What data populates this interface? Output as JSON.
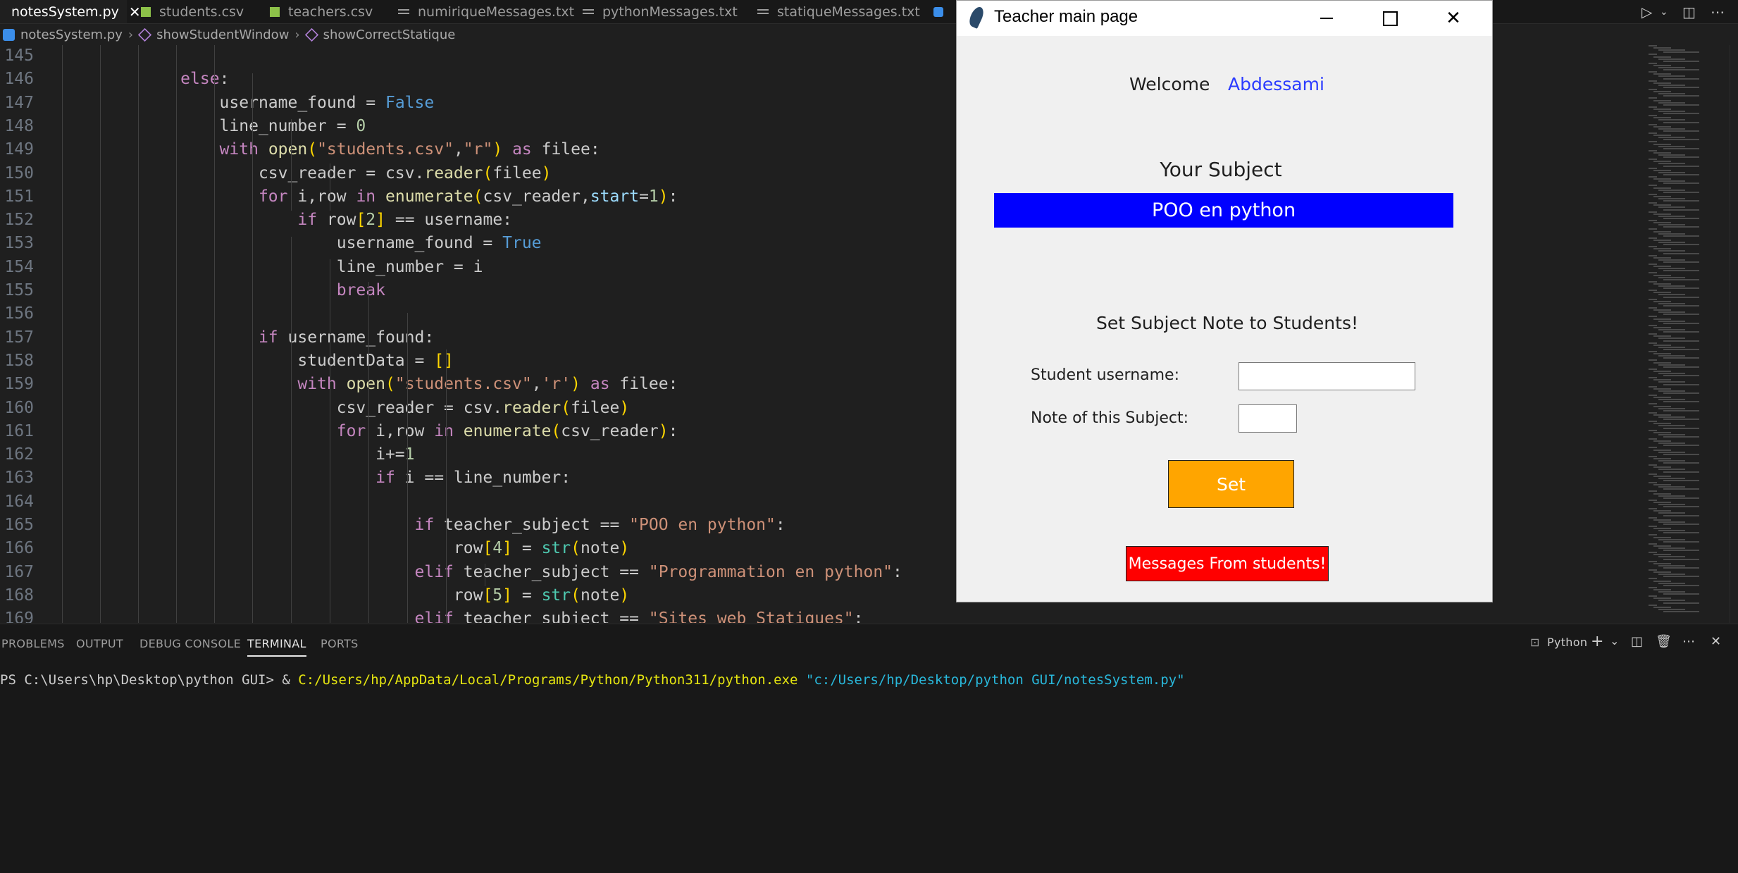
{
  "editor_tabs": [
    {
      "label": "notesSystem.py",
      "close": "✕",
      "type": "py"
    },
    {
      "label": "students.csv",
      "type": "csv"
    },
    {
      "label": "teachers.csv",
      "type": "csv"
    },
    {
      "label": "numiriqueMessages.txt",
      "type": "txt"
    },
    {
      "label": "pythonMessages.txt",
      "type": "txt"
    },
    {
      "label": "statiqueMessages.txt",
      "type": "txt"
    }
  ],
  "breadcrumbs": [
    "notesSystem.py",
    "showStudentWindow",
    "showCorrectStatique"
  ],
  "code_lines": [
    {
      "n": "145",
      "tokens": []
    },
    {
      "n": "146",
      "tokens": [
        {
          "t": "            ",
          "c": "#cccccc"
        },
        {
          "t": "else",
          "c": "#c586c0"
        },
        {
          "t": ":",
          "c": "#cccccc"
        }
      ]
    },
    {
      "n": "147",
      "tokens": [
        {
          "t": "                username_found = ",
          "c": "#cccccc"
        },
        {
          "t": "False",
          "c": "#569cd6"
        }
      ]
    },
    {
      "n": "148",
      "tokens": [
        {
          "t": "                line_number = ",
          "c": "#cccccc"
        },
        {
          "t": "0",
          "c": "#b5cea8"
        }
      ]
    },
    {
      "n": "149",
      "tokens": [
        {
          "t": "                ",
          "c": "#cccccc"
        },
        {
          "t": "with",
          "c": "#c586c0"
        },
        {
          "t": " ",
          "c": "#cccccc"
        },
        {
          "t": "open",
          "c": "#dcdcaa"
        },
        {
          "t": "(",
          "c": "#ffd700"
        },
        {
          "t": "\"students.csv\"",
          "c": "#ce9178"
        },
        {
          "t": ",",
          "c": "#cccccc"
        },
        {
          "t": "\"r\"",
          "c": "#ce9178"
        },
        {
          "t": ")",
          "c": "#ffd700"
        },
        {
          "t": " ",
          "c": "#cccccc"
        },
        {
          "t": "as",
          "c": "#c586c0"
        },
        {
          "t": " filee:",
          "c": "#cccccc"
        }
      ]
    },
    {
      "n": "150",
      "tokens": [
        {
          "t": "                    csv_reader = csv.",
          "c": "#cccccc"
        },
        {
          "t": "reader",
          "c": "#dcdcaa"
        },
        {
          "t": "(",
          "c": "#ffd700"
        },
        {
          "t": "filee",
          "c": "#cccccc"
        },
        {
          "t": ")",
          "c": "#ffd700"
        }
      ]
    },
    {
      "n": "151",
      "tokens": [
        {
          "t": "                    ",
          "c": "#cccccc"
        },
        {
          "t": "for",
          "c": "#c586c0"
        },
        {
          "t": " i,row ",
          "c": "#cccccc"
        },
        {
          "t": "in",
          "c": "#c586c0"
        },
        {
          "t": " ",
          "c": "#cccccc"
        },
        {
          "t": "enumerate",
          "c": "#dcdcaa"
        },
        {
          "t": "(",
          "c": "#ffd700"
        },
        {
          "t": "csv_reader,",
          "c": "#cccccc"
        },
        {
          "t": "start",
          "c": "#9cdcfe"
        },
        {
          "t": "=",
          "c": "#cccccc"
        },
        {
          "t": "1",
          "c": "#b5cea8"
        },
        {
          "t": ")",
          "c": "#ffd700"
        },
        {
          "t": ":",
          "c": "#cccccc"
        }
      ]
    },
    {
      "n": "152",
      "tokens": [
        {
          "t": "                        ",
          "c": "#cccccc"
        },
        {
          "t": "if",
          "c": "#c586c0"
        },
        {
          "t": " row",
          "c": "#cccccc"
        },
        {
          "t": "[",
          "c": "#ffd700"
        },
        {
          "t": "2",
          "c": "#b5cea8"
        },
        {
          "t": "]",
          "c": "#ffd700"
        },
        {
          "t": " == username:",
          "c": "#cccccc"
        }
      ]
    },
    {
      "n": "153",
      "tokens": [
        {
          "t": "                            username_found = ",
          "c": "#cccccc"
        },
        {
          "t": "True",
          "c": "#569cd6"
        }
      ]
    },
    {
      "n": "154",
      "tokens": [
        {
          "t": "                            line_number = i",
          "c": "#cccccc"
        }
      ]
    },
    {
      "n": "155",
      "tokens": [
        {
          "t": "                            ",
          "c": "#cccccc"
        },
        {
          "t": "break",
          "c": "#c586c0"
        }
      ]
    },
    {
      "n": "156",
      "tokens": []
    },
    {
      "n": "157",
      "tokens": [
        {
          "t": "                    ",
          "c": "#cccccc"
        },
        {
          "t": "if",
          "c": "#c586c0"
        },
        {
          "t": " username_found:",
          "c": "#cccccc"
        }
      ]
    },
    {
      "n": "158",
      "tokens": [
        {
          "t": "                        studentData = ",
          "c": "#cccccc"
        },
        {
          "t": "[]",
          "c": "#ffd700"
        }
      ]
    },
    {
      "n": "159",
      "tokens": [
        {
          "t": "                        ",
          "c": "#cccccc"
        },
        {
          "t": "with",
          "c": "#c586c0"
        },
        {
          "t": " ",
          "c": "#cccccc"
        },
        {
          "t": "open",
          "c": "#dcdcaa"
        },
        {
          "t": "(",
          "c": "#ffd700"
        },
        {
          "t": "\"students.csv\"",
          "c": "#ce9178"
        },
        {
          "t": ",",
          "c": "#cccccc"
        },
        {
          "t": "'r'",
          "c": "#ce9178"
        },
        {
          "t": ")",
          "c": "#ffd700"
        },
        {
          "t": " ",
          "c": "#cccccc"
        },
        {
          "t": "as",
          "c": "#c586c0"
        },
        {
          "t": " filee:",
          "c": "#cccccc"
        }
      ]
    },
    {
      "n": "160",
      "tokens": [
        {
          "t": "                            csv_reader = csv.",
          "c": "#cccccc"
        },
        {
          "t": "reader",
          "c": "#dcdcaa"
        },
        {
          "t": "(",
          "c": "#ffd700"
        },
        {
          "t": "filee",
          "c": "#cccccc"
        },
        {
          "t": ")",
          "c": "#ffd700"
        }
      ]
    },
    {
      "n": "161",
      "tokens": [
        {
          "t": "                            ",
          "c": "#cccccc"
        },
        {
          "t": "for",
          "c": "#c586c0"
        },
        {
          "t": " i,row ",
          "c": "#cccccc"
        },
        {
          "t": "in",
          "c": "#c586c0"
        },
        {
          "t": " ",
          "c": "#cccccc"
        },
        {
          "t": "enumerate",
          "c": "#dcdcaa"
        },
        {
          "t": "(",
          "c": "#ffd700"
        },
        {
          "t": "csv_reader",
          "c": "#cccccc"
        },
        {
          "t": ")",
          "c": "#ffd700"
        },
        {
          "t": ":",
          "c": "#cccccc"
        }
      ]
    },
    {
      "n": "162",
      "tokens": [
        {
          "t": "                                i+=",
          "c": "#cccccc"
        },
        {
          "t": "1",
          "c": "#b5cea8"
        }
      ]
    },
    {
      "n": "163",
      "tokens": [
        {
          "t": "                                ",
          "c": "#cccccc"
        },
        {
          "t": "if",
          "c": "#c586c0"
        },
        {
          "t": " i == line_number:",
          "c": "#cccccc"
        }
      ]
    },
    {
      "n": "164",
      "tokens": []
    },
    {
      "n": "165",
      "tokens": [
        {
          "t": "                                    ",
          "c": "#cccccc"
        },
        {
          "t": "if",
          "c": "#c586c0"
        },
        {
          "t": " teacher_subject == ",
          "c": "#cccccc"
        },
        {
          "t": "\"POO en python\"",
          "c": "#ce9178"
        },
        {
          "t": ":",
          "c": "#cccccc"
        }
      ]
    },
    {
      "n": "166",
      "tokens": [
        {
          "t": "                                        row",
          "c": "#cccccc"
        },
        {
          "t": "[",
          "c": "#ffd700"
        },
        {
          "t": "4",
          "c": "#b5cea8"
        },
        {
          "t": "]",
          "c": "#ffd700"
        },
        {
          "t": " = ",
          "c": "#cccccc"
        },
        {
          "t": "str",
          "c": "#4ec9b0"
        },
        {
          "t": "(",
          "c": "#ffd700"
        },
        {
          "t": "note",
          "c": "#cccccc"
        },
        {
          "t": ")",
          "c": "#ffd700"
        }
      ]
    },
    {
      "n": "167",
      "tokens": [
        {
          "t": "                                    ",
          "c": "#cccccc"
        },
        {
          "t": "elif",
          "c": "#c586c0"
        },
        {
          "t": " teacher_subject == ",
          "c": "#cccccc"
        },
        {
          "t": "\"Programmation en python\"",
          "c": "#ce9178"
        },
        {
          "t": ":",
          "c": "#cccccc"
        }
      ]
    },
    {
      "n": "168",
      "tokens": [
        {
          "t": "                                        row",
          "c": "#cccccc"
        },
        {
          "t": "[",
          "c": "#ffd700"
        },
        {
          "t": "5",
          "c": "#b5cea8"
        },
        {
          "t": "]",
          "c": "#ffd700"
        },
        {
          "t": " = ",
          "c": "#cccccc"
        },
        {
          "t": "str",
          "c": "#4ec9b0"
        },
        {
          "t": "(",
          "c": "#ffd700"
        },
        {
          "t": "note",
          "c": "#cccccc"
        },
        {
          "t": ")",
          "c": "#ffd700"
        }
      ]
    },
    {
      "n": "169",
      "tokens": [
        {
          "t": "                                    ",
          "c": "#cccccc"
        },
        {
          "t": "elif",
          "c": "#c586c0"
        },
        {
          "t": " teacher_subject == ",
          "c": "#cccccc"
        },
        {
          "t": "\"Sites web Statiques\"",
          "c": "#ce9178"
        },
        {
          "t": ":",
          "c": "#cccccc"
        }
      ]
    }
  ],
  "panel": {
    "tabs": [
      "PROBLEMS",
      "OUTPUT",
      "DEBUG CONSOLE",
      "TERMINAL",
      "PORTS"
    ],
    "active_tab": "TERMINAL",
    "terminal_profile": "Python",
    "prompt": "PS C:\\Users\\hp\\Desktop\\python GUI> & ",
    "exe": "C:/Users/hp/AppData/Local/Programs/Python/Python311/python.exe",
    "arg": " \"c:/Users/hp/Desktop/python GUI/notesSystem.py\""
  },
  "tk_window": {
    "title": "Teacher main page",
    "welcome_label": "Welcome",
    "username": "Abdessami",
    "subject_heading": "Your Subject",
    "subject_value": "POO en python",
    "set_note_heading": "Set Subject Note to Students!",
    "student_username_label": "Student username:",
    "student_username_value": "",
    "note_label": "Note of this Subject:",
    "note_value": "",
    "set_button": "Set",
    "messages_button": "Messages From students!"
  },
  "colors": {
    "subject_bar": "#0000ff",
    "username": "#2b3bff",
    "set_button": "#ffa500",
    "messages_button": "#ff0000",
    "terminal_exe": "#e5e510",
    "terminal_arg": "#29b8db"
  }
}
